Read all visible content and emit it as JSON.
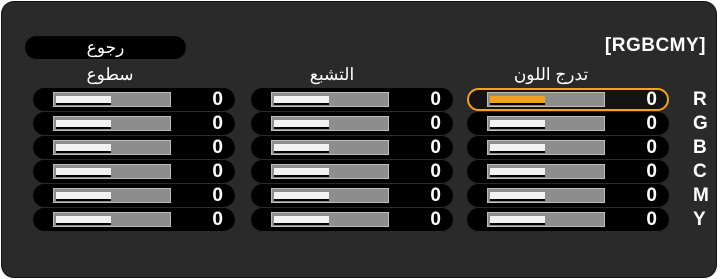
{
  "menu": {
    "title": "[RGBCMY]",
    "back_label": "رجوع",
    "columns": [
      "سطوع",
      "التشبع",
      "تدرج اللون"
    ],
    "rows": [
      {
        "label": "R",
        "brightness": "0",
        "saturation": "0",
        "hue": "0"
      },
      {
        "label": "G",
        "brightness": "0",
        "saturation": "0",
        "hue": "0"
      },
      {
        "label": "B",
        "brightness": "0",
        "saturation": "0",
        "hue": "0"
      },
      {
        "label": "C",
        "brightness": "0",
        "saturation": "0",
        "hue": "0"
      },
      {
        "label": "M",
        "brightness": "0",
        "saturation": "0",
        "hue": "0"
      },
      {
        "label": "Y",
        "brightness": "0",
        "saturation": "0",
        "hue": "0"
      }
    ],
    "slider_level": 0.5,
    "selected": {
      "row": "R",
      "column": "تدرج اللون"
    }
  },
  "colors": {
    "panel": "#2a2a2a",
    "highlight": "#f3a21c",
    "text": "#ffffff"
  }
}
